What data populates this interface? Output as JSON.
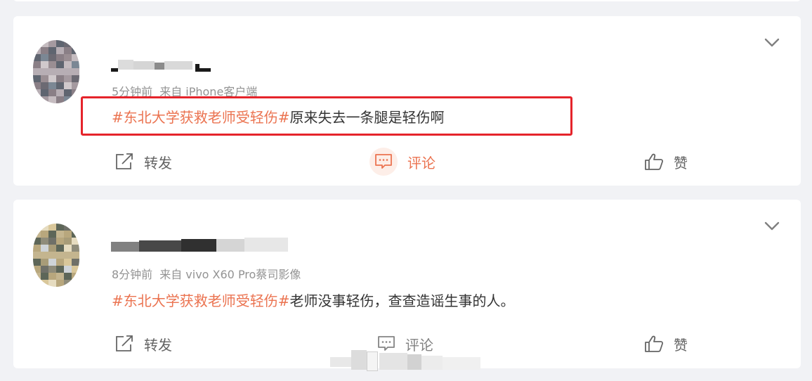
{
  "posts": [
    {
      "meta_time": "5分钟前",
      "meta_source": "来自 iPhone客户端",
      "topic": "#东北大学获救老师受轻伤#",
      "body_text": "原来失去一条腿是轻伤啊",
      "actions": {
        "repost": "转发",
        "comment": "评论",
        "like": "赞"
      },
      "comment_active": true
    },
    {
      "meta_time": "8分钟前",
      "meta_source": "来自 vivo X60 Pro蔡司影像",
      "topic": "#东北大学获救老师受轻伤#",
      "body_text": "老师没事轻伤，查查造谣生事的人。",
      "actions": {
        "repost": "转发",
        "comment": "评论",
        "like": "赞"
      },
      "comment_active": false
    }
  ],
  "colors": {
    "topic": "#eb7350",
    "annotation_box": "#e5242b",
    "meta": "#939393",
    "text": "#333333",
    "background": "#f1f2f5"
  },
  "icons": {
    "more": "chevron-down-icon",
    "repost": "share-icon",
    "comment": "comment-icon",
    "like": "thumbs-up-icon"
  }
}
